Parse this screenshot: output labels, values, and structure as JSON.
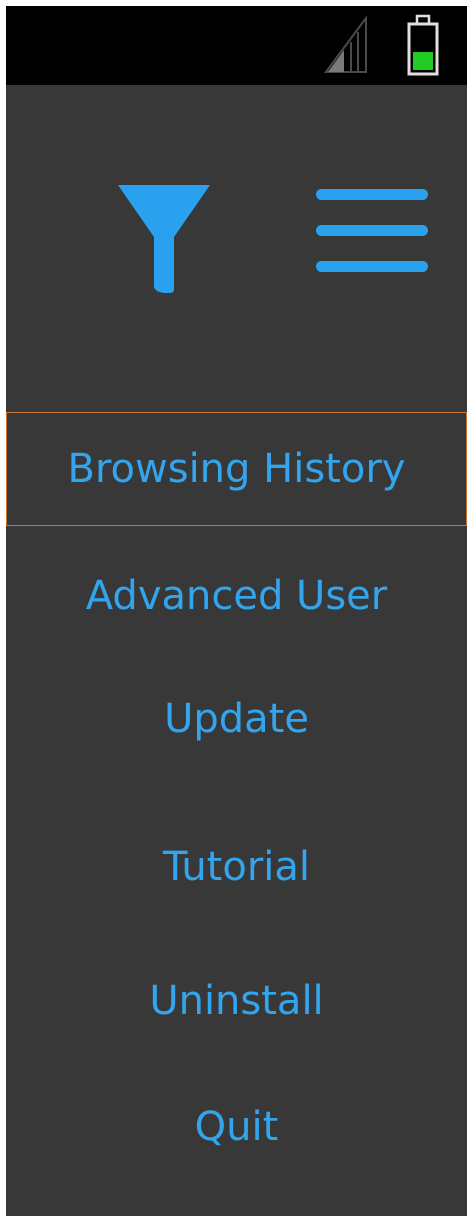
{
  "status_bar": {
    "signal_icon": "signal-strength-icon",
    "battery_icon": "battery-icon",
    "battery_color": "#22cc22"
  },
  "toolbar": {
    "filter_icon": "filter-funnel-icon",
    "menu_icon": "hamburger-menu-icon",
    "accent_color": "#2aa1ef"
  },
  "menu": {
    "items": [
      {
        "label": "Browsing History"
      },
      {
        "label": "Advanced User"
      },
      {
        "label": "Update"
      },
      {
        "label": "Tutorial"
      },
      {
        "label": "Uninstall"
      },
      {
        "label": "Quit"
      }
    ]
  }
}
